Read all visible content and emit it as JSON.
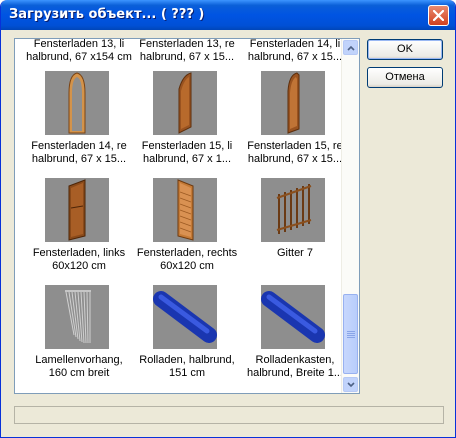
{
  "window": {
    "title": "Загрузить объект...    ( ??? )"
  },
  "buttons": {
    "ok": "OK",
    "cancel": "Отмена"
  },
  "items": [
    {
      "line1": "Fensterladen 13, li",
      "line2": "halbrund, 67 x154 cm",
      "icon": "arched-shutter-icon"
    },
    {
      "line1": "Fensterladen 13, re",
      "line2": "halbrund, 67 x 15...",
      "icon": "arched-shutter-icon"
    },
    {
      "line1": "Fensterladen 14, li",
      "line2": "halbrund, 67 x 15...",
      "icon": "arched-shutter-icon"
    },
    {
      "line1": "Fensterladen 14, re",
      "line2": "halbrund, 67 x 15...",
      "icon": "arched-frame-icon"
    },
    {
      "line1": "Fensterladen 15, li",
      "line2": "halbrund, 67 x 1...",
      "icon": "arched-shutter-left-icon"
    },
    {
      "line1": "Fensterladen 15, re",
      "line2": "halbrund, 67 x 15...",
      "icon": "arched-shutter-right-icon"
    },
    {
      "line1": "Fensterladen, links",
      "line2": "60x120 cm",
      "icon": "shutter-left-icon"
    },
    {
      "line1": "Fensterladen, rechts",
      "line2": "60x120 cm",
      "icon": "shutter-right-icon"
    },
    {
      "line1": "Gitter 7",
      "line2": "",
      "icon": "grille-icon"
    },
    {
      "line1": "Lamellenvorhang,",
      "line2": "160 cm breit",
      "icon": "vertical-blind-icon"
    },
    {
      "line1": "Rolladen, halbrund,",
      "line2": "151 cm",
      "icon": "roller-shutter-icon"
    },
    {
      "line1": "Rolladenkasten,",
      "line2": "halbrund, Breite 1...",
      "icon": "roller-box-icon"
    }
  ],
  "colors": {
    "thumb_bg": "#8e8e8e",
    "wood": "#c8853a",
    "wood_dark": "#8a4f1d",
    "roller": "#1e3fbf"
  }
}
